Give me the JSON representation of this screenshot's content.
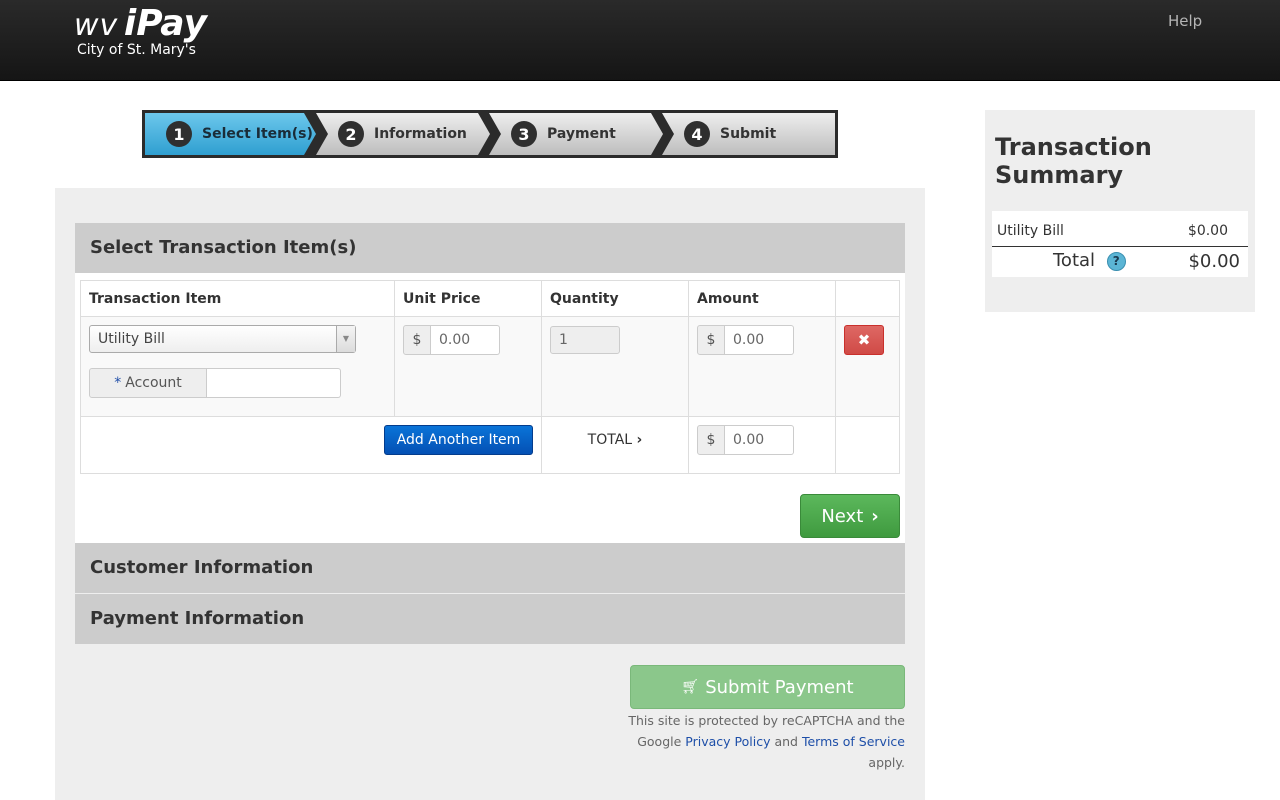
{
  "header": {
    "logo_wv": "wv",
    "logo_ipay": "iPay",
    "logo_sub": "City of St. Mary's",
    "help": "Help"
  },
  "steps": [
    {
      "num": "1",
      "label": "Select Item(s)",
      "active": true
    },
    {
      "num": "2",
      "label": "Information"
    },
    {
      "num": "3",
      "label": "Payment"
    },
    {
      "num": "4",
      "label": "Submit"
    }
  ],
  "sections": {
    "select": "Select Transaction Item(s)",
    "customer": "Customer Information",
    "payment": "Payment Information"
  },
  "table": {
    "headers": [
      "Transaction Item",
      "Unit Price",
      "Quantity",
      "Amount"
    ],
    "row": {
      "item": "Utility Bill",
      "account_label": "Account",
      "account_required": "*",
      "account_value": "",
      "currency": "$",
      "unit_price": "0.00",
      "quantity": "1",
      "amount": "0.00"
    },
    "add_button": "Add Another Item",
    "total_label": "TOTAL",
    "total_currency": "$",
    "total_amount": "0.00"
  },
  "buttons": {
    "next": "Next",
    "submit": "Submit Payment"
  },
  "recaptcha": {
    "line1": "This site is protected by reCAPTCHA and the",
    "google": "Google",
    "privacy": "Privacy Policy",
    "and": "and",
    "terms": "Terms of Service",
    "apply": "apply."
  },
  "summary": {
    "title": "Transaction Summary",
    "item_label": "Utility Bill",
    "item_amount": "$0.00",
    "total_label": "Total",
    "total_amount": "$0.00"
  }
}
